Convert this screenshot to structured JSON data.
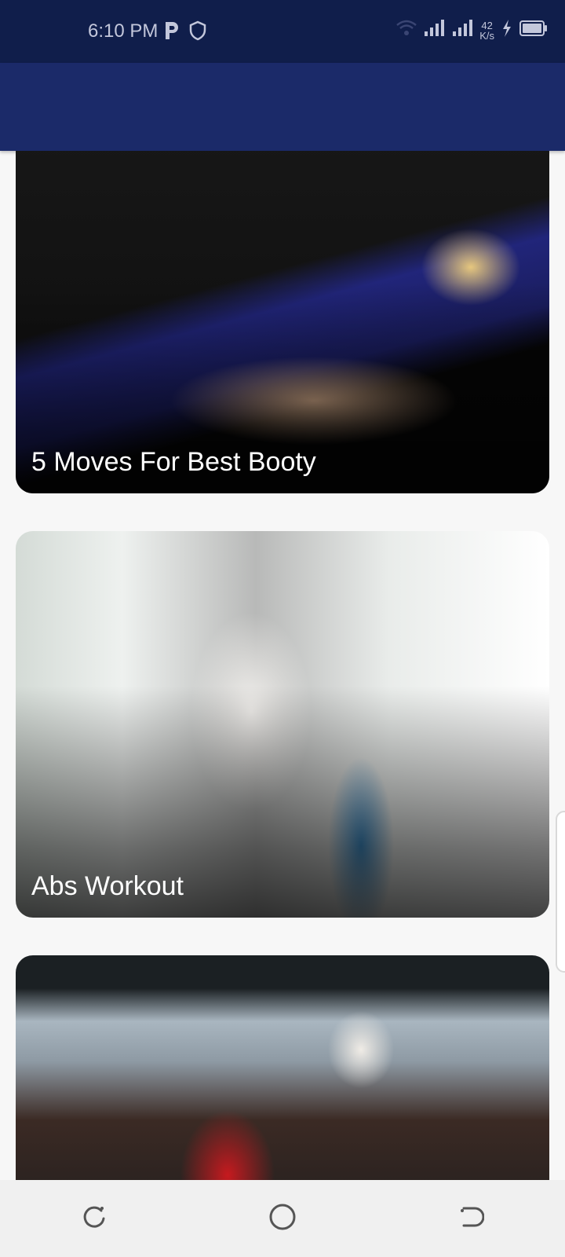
{
  "status_bar": {
    "time": "6:10 PM",
    "network_speed_value": "42",
    "network_speed_unit": "K/s",
    "icons": [
      "p-icon",
      "shield-icon",
      "wifi-icon",
      "signal-icon",
      "signal-icon",
      "charging-icon",
      "battery-icon"
    ]
  },
  "app_bar": {},
  "cards": [
    {
      "title": "5 Moves For Best Booty"
    },
    {
      "title": "Abs Workout"
    },
    {
      "title": ""
    }
  ],
  "nav_bar": {
    "icons": [
      "recents-icon",
      "home-icon",
      "back-icon"
    ]
  },
  "colors": {
    "status_bar": "#101e4b",
    "app_bar": "#1b2a69",
    "background": "#f7f7f7",
    "nav_bar": "#f0f0f0"
  }
}
